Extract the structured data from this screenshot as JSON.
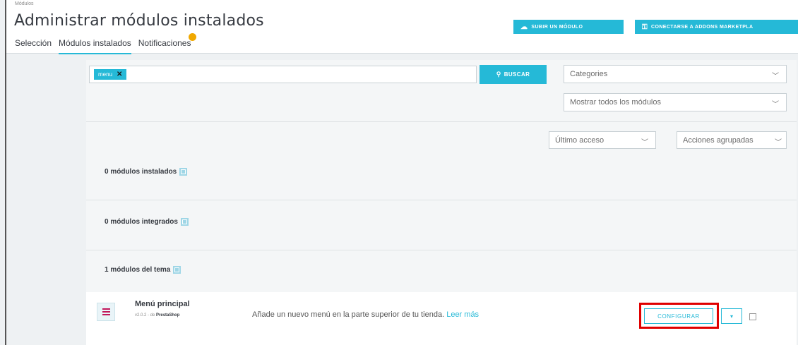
{
  "header": {
    "breadcrumb": "Módulos",
    "title": "Administrar módulos instalados",
    "tabs": [
      {
        "label": "Selección"
      },
      {
        "label": "Módulos instalados",
        "active": true
      },
      {
        "label": "Notificaciones"
      }
    ],
    "upload_button": "SUBIR UN MÓDULO",
    "addons_button": "CONECTARSE A ADDONS MARKETPLA"
  },
  "search": {
    "tag": "menu",
    "tag_remove": "✕",
    "button": "BUSCAR"
  },
  "filters": {
    "categories": "Categories",
    "status": "Mostrar todos los módulos",
    "sort": "Último acceso",
    "bulk_actions": "Acciones agrupadas"
  },
  "sections": [
    {
      "label": "0 módulos instalados"
    },
    {
      "label": "0 módulos integrados"
    },
    {
      "label": "1 módulos del tema"
    }
  ],
  "module": {
    "name": "Menú principal",
    "version": "v2.0.2 - de",
    "author": "PrestaShop",
    "description": "Añade un nuevo menú en la parte superior de tu tienda.",
    "read_more": "Leer más",
    "configure_button": "CONFIGURAR"
  },
  "colors": {
    "accent": "#25b9d7",
    "highlight": "#e00000",
    "badge": "#f0a800"
  },
  "icons": {
    "upload": "cloud-upload-icon",
    "addons": "key-icon",
    "search": "search-icon",
    "chevron": "chevron-down-icon",
    "module": "menu-icon"
  }
}
